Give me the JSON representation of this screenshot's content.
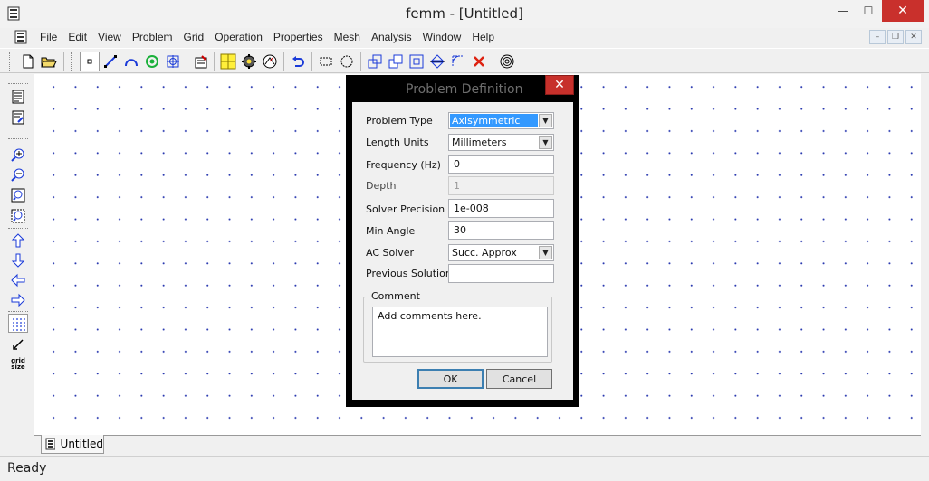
{
  "window": {
    "title": "femm - [Untitled]",
    "minimize_label": "—",
    "maximize_label": "☐",
    "close_label": "✕"
  },
  "menu": {
    "items": [
      "File",
      "Edit",
      "View",
      "Problem",
      "Grid",
      "Operation",
      "Properties",
      "Mesh",
      "Analysis",
      "Window",
      "Help"
    ]
  },
  "mdi": {
    "minimize": "–",
    "restore": "❐",
    "close": "✕"
  },
  "tabs": {
    "document": "Untitled"
  },
  "left_toolbar": {
    "grid_size_line1": "grid",
    "grid_size_line2": "size"
  },
  "status": {
    "text": "Ready"
  },
  "dialog": {
    "title": "Problem Definition",
    "close_label": "✕",
    "fields": {
      "problem_type": {
        "label": "Problem Type",
        "value": "Axisymmetric"
      },
      "length_units": {
        "label": "Length Units",
        "value": "Millimeters"
      },
      "frequency": {
        "label": "Frequency (Hz)",
        "value": "0"
      },
      "depth": {
        "label": "Depth",
        "value": "1"
      },
      "solver_precision": {
        "label": "Solver Precision",
        "value": "1e-008"
      },
      "min_angle": {
        "label": "Min Angle",
        "value": "30"
      },
      "ac_solver": {
        "label": "AC Solver",
        "value": "Succ. Approx"
      },
      "previous_solution": {
        "label": "Previous Solution",
        "value": ""
      }
    },
    "comment": {
      "legend": "Comment",
      "value": "Add comments here."
    },
    "ok_label": "OK",
    "cancel_label": "Cancel"
  }
}
